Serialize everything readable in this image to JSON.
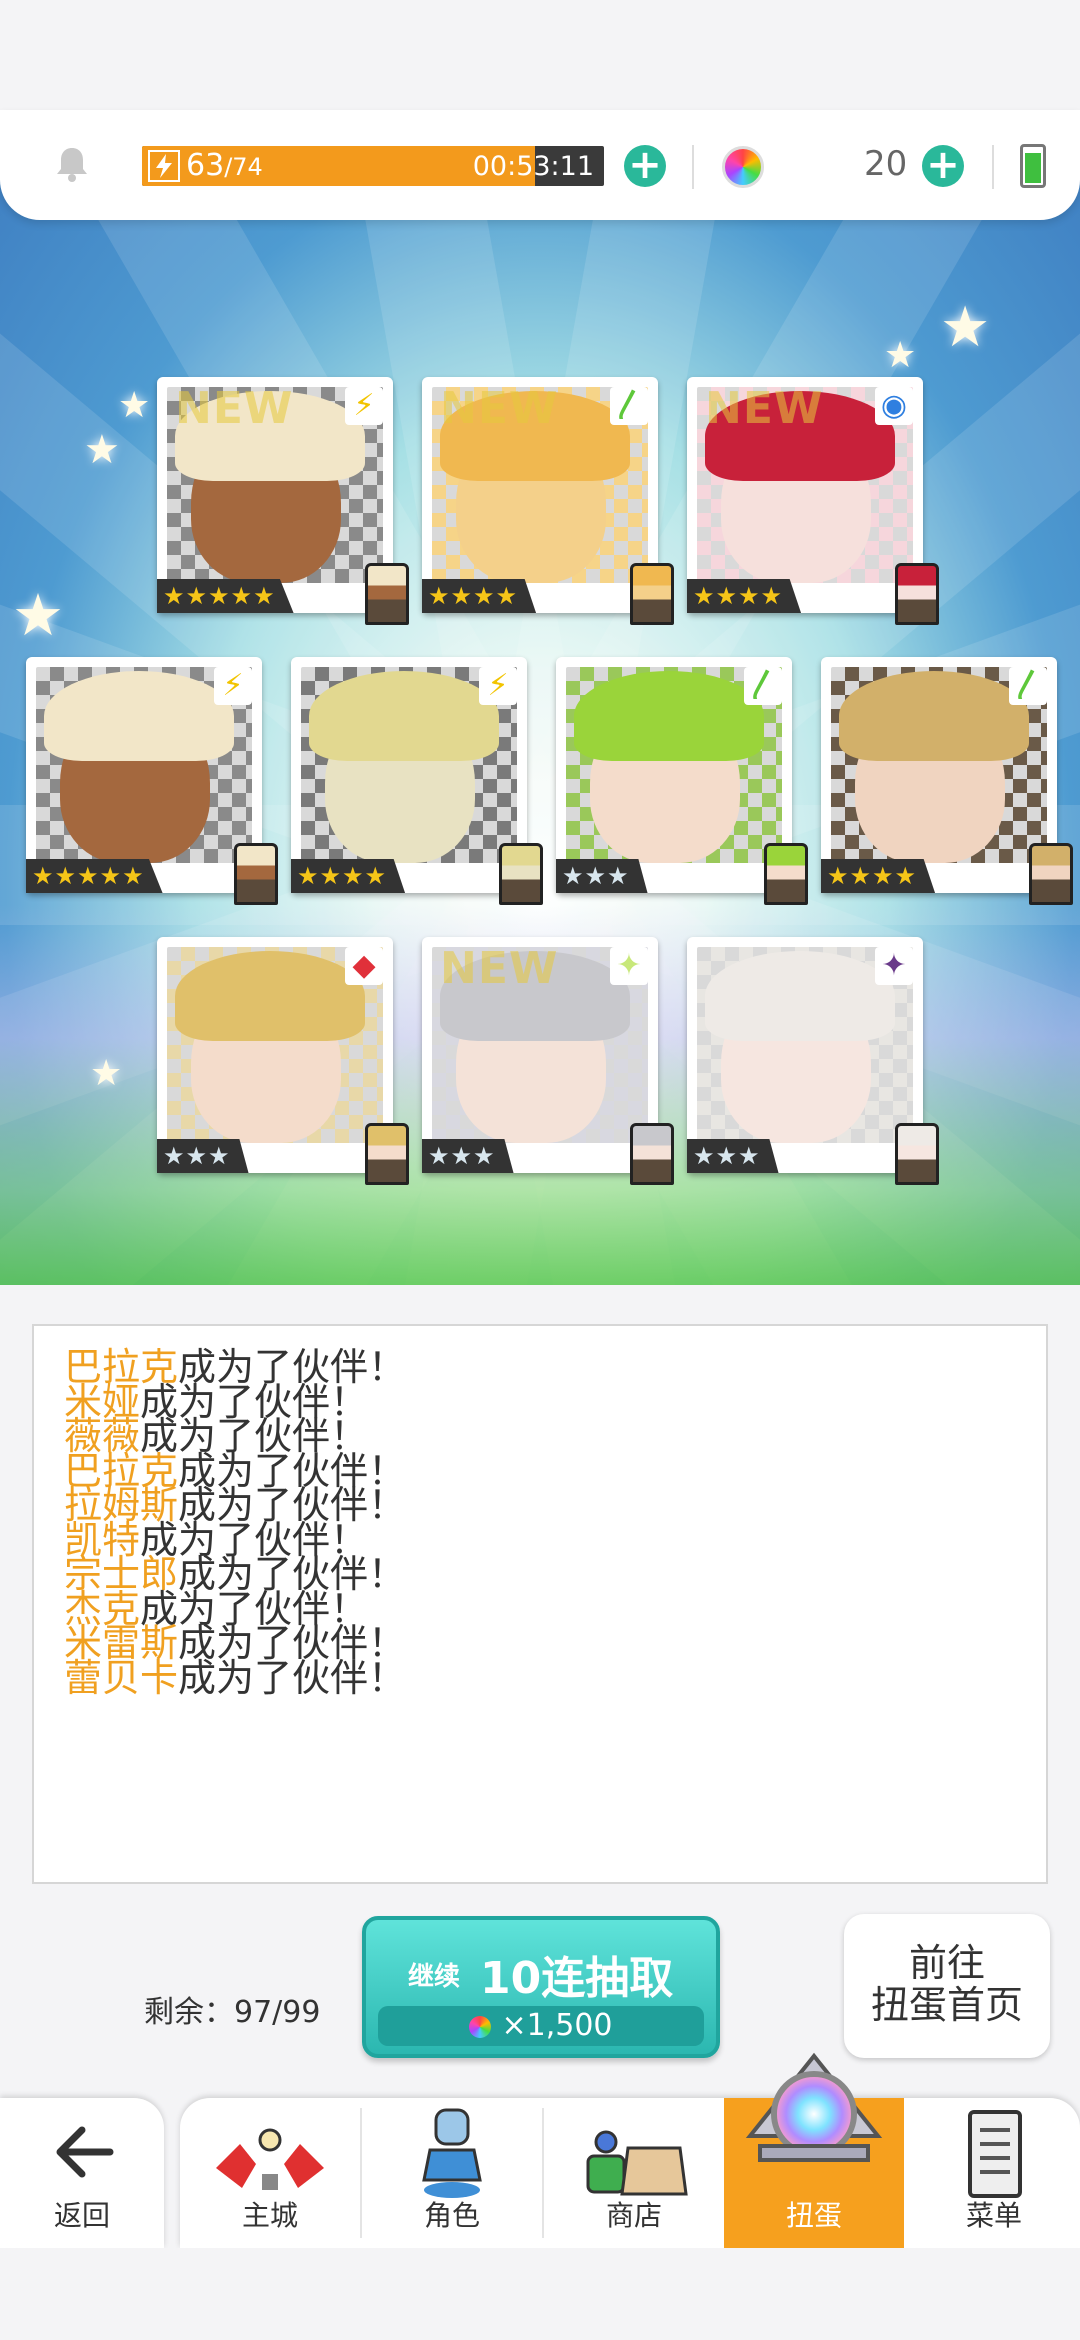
{
  "topbar": {
    "stamina_current": "63",
    "stamina_max": "/74",
    "stamina_fraction": 0.85,
    "stamina_timer": "00:53:11",
    "gem_count": "20"
  },
  "cards": [
    {
      "new": true,
      "element": "lightning",
      "rarity": "★★★★★",
      "tone": "gold"
    },
    {
      "new": true,
      "element": "wind",
      "rarity": "★★★★",
      "tone": "gold"
    },
    {
      "new": true,
      "element": "water",
      "rarity": "★★★★",
      "tone": "gold"
    },
    {
      "new": false,
      "element": "lightning",
      "rarity": "★★★★★",
      "tone": "gold"
    },
    {
      "new": false,
      "element": "lightning",
      "rarity": "★★★★",
      "tone": "gold"
    },
    {
      "new": false,
      "element": "wind",
      "rarity": "★★★",
      "tone": "silver"
    },
    {
      "new": false,
      "element": "wind",
      "rarity": "★★★★",
      "tone": "gold"
    },
    {
      "new": false,
      "element": "fire",
      "rarity": "★★★",
      "tone": "silver"
    },
    {
      "new": true,
      "element": "light",
      "rarity": "★★★",
      "tone": "silver"
    },
    {
      "new": false,
      "element": "dark",
      "rarity": "★★★",
      "tone": "silver"
    }
  ],
  "new_tag": "NEW",
  "log": {
    "suffix": "成为了伙伴！",
    "names": [
      "巴拉克",
      "米娅",
      "薇薇",
      "巴拉克",
      "拉姆斯",
      "凯特",
      "宗士郎",
      "杰克",
      "米雷斯",
      "蕾贝卡"
    ]
  },
  "actions": {
    "remaining": "剩余：97/99",
    "continue_label": "继续",
    "draw_label": "10连抽取",
    "draw_cost": "×1,500",
    "home_line1": "前往",
    "home_line2": "扭蛋首页"
  },
  "nav": {
    "back": "返回",
    "tabs": [
      "主城",
      "角色",
      "商店",
      "扭蛋",
      "菜单"
    ],
    "active": "扭蛋"
  }
}
